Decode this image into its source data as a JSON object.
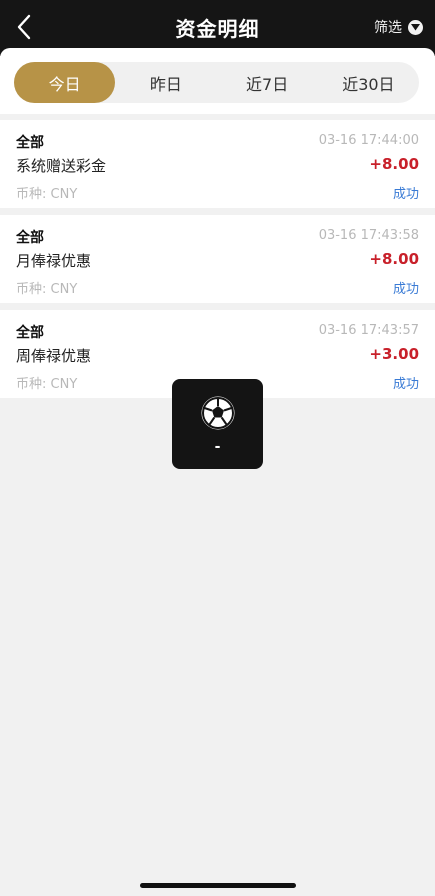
{
  "header": {
    "title": "资金明细",
    "filter_label": "筛选"
  },
  "tabs": [
    {
      "label": "今日",
      "active": true
    },
    {
      "label": "昨日",
      "active": false
    },
    {
      "label": "近7日",
      "active": false
    },
    {
      "label": "近30日",
      "active": false
    }
  ],
  "records": [
    {
      "category": "全部",
      "time": "03-16 17:44:00",
      "description": "系统赠送彩金",
      "amount": "+8.00",
      "currency": "币种: CNY",
      "status": "成功"
    },
    {
      "category": "全部",
      "time": "03-16 17:43:58",
      "description": "月俸禄优惠",
      "amount": "+8.00",
      "currency": "币种: CNY",
      "status": "成功"
    },
    {
      "category": "全部",
      "time": "03-16 17:43:57",
      "description": "周俸禄优惠",
      "amount": "+3.00",
      "currency": "币种: CNY",
      "status": "成功"
    }
  ],
  "toast": {
    "message": "-"
  },
  "colors": {
    "header_bg": "#151515",
    "accent": "#b79347",
    "amount_positive": "#c8202a",
    "status_success": "#3a7bd5"
  }
}
